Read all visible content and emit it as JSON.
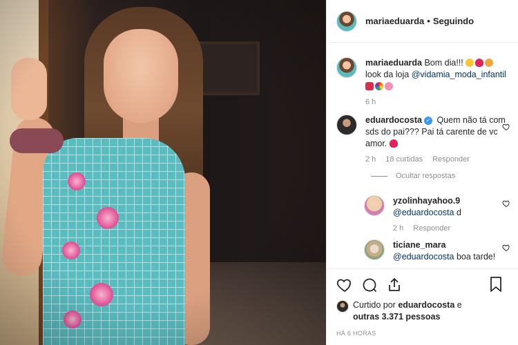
{
  "post": {
    "author": "mariaeduarda",
    "separator": "•",
    "follow_status": "Seguindo"
  },
  "caption": {
    "author": "mariaeduarda",
    "text": "Bom dia!!!",
    "line2_prefix": "look da loja",
    "mention": "@vidamia_moda_infantil",
    "time": "6 h"
  },
  "comment1": {
    "author": "eduardocosta",
    "verified_mark": "✓",
    "text": "Quem não tá com sds do pai??? Pai tá carente de vc amor.",
    "time": "2 h",
    "likes": "18 curtidas",
    "reply": "Responder",
    "hide_replies": "Ocultar respostas"
  },
  "reply1": {
    "author": "yzolinhayahoo.9",
    "mention": "@eduardocosta",
    "text": "d",
    "time": "2 h",
    "reply": "Responder"
  },
  "reply2": {
    "author": "ticiane_mara",
    "mention": "@eduardocosta",
    "text": "boa tarde!"
  },
  "likes": {
    "prefix": "Curtido por",
    "user": "eduardocosta",
    "conj": "e",
    "others": "outras 3.371 pessoas"
  },
  "timestamp": "HÁ 6 HORAS",
  "icons": [
    "heart-icon",
    "comment-icon",
    "share-icon",
    "bookmark-icon",
    "verified-icon"
  ],
  "colors": {
    "link": "#003569",
    "muted": "#8e8e8e",
    "verified": "#3897f0",
    "heart_emoji": "#e0245e"
  }
}
